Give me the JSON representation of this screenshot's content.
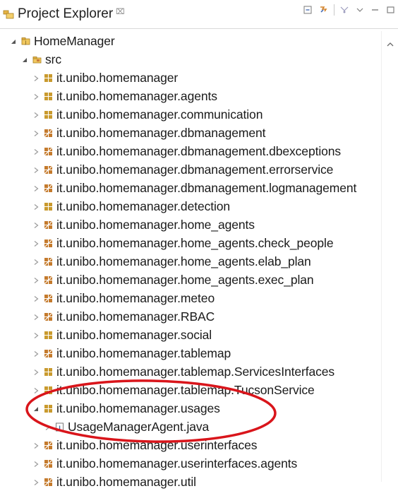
{
  "colors": {
    "annotation": "#d9151b",
    "package_accent": "#c99a2e",
    "package_alt": "#c47a2c",
    "folder": "#e6b445",
    "text": "#1a1a1a"
  },
  "view": {
    "title": "Project Explorer",
    "close_glyph": "⌧",
    "toolbar": {
      "collapse_icon": "collapse-all-icon",
      "link_icon": "link-with-editor-icon",
      "filter_icon": "filter-icon",
      "menu_icon": "view-menu-icon",
      "minimize_icon": "minimize-icon",
      "maximize_icon": "maximize-icon"
    }
  },
  "tree": {
    "project": {
      "label": "HomeManager",
      "expanded": true
    },
    "src": {
      "label": "src",
      "expanded": true
    },
    "packages": [
      {
        "label": "it.unibo.homemanager",
        "icon": "package-icon"
      },
      {
        "label": "it.unibo.homemanager.agents",
        "icon": "package-icon"
      },
      {
        "label": "it.unibo.homemanager.communication",
        "icon": "package-icon"
      },
      {
        "label": "it.unibo.homemanager.dbmanagement",
        "icon": "package-alt-icon"
      },
      {
        "label": "it.unibo.homemanager.dbmanagement.dbexceptions",
        "icon": "package-alt-icon"
      },
      {
        "label": "it.unibo.homemanager.dbmanagement.errorservice",
        "icon": "package-alt-icon"
      },
      {
        "label": "it.unibo.homemanager.dbmanagement.logmanagement",
        "icon": "package-alt-icon"
      },
      {
        "label": "it.unibo.homemanager.detection",
        "icon": "package-icon"
      },
      {
        "label": "it.unibo.homemanager.home_agents",
        "icon": "package-alt-icon"
      },
      {
        "label": "it.unibo.homemanager.home_agents.check_people",
        "icon": "package-alt-icon"
      },
      {
        "label": "it.unibo.homemanager.home_agents.elab_plan",
        "icon": "package-alt-icon"
      },
      {
        "label": "it.unibo.homemanager.home_agents.exec_plan",
        "icon": "package-alt-icon"
      },
      {
        "label": "it.unibo.homemanager.meteo",
        "icon": "package-alt-icon"
      },
      {
        "label": "it.unibo.homemanager.RBAC",
        "icon": "package-alt-icon"
      },
      {
        "label": "it.unibo.homemanager.social",
        "icon": "package-icon"
      },
      {
        "label": "it.unibo.homemanager.tablemap",
        "icon": "package-alt-icon"
      },
      {
        "label": "it.unibo.homemanager.tablemap.ServicesInterfaces",
        "icon": "package-icon"
      },
      {
        "label": "it.unibo.homemanager.tablemap.TucsonService",
        "icon": "package-icon"
      },
      {
        "label": "it.unibo.homemanager.usages",
        "icon": "package-icon",
        "expanded": true
      },
      {
        "label": "UsageManagerAgent.java",
        "icon": "java-file-icon",
        "child": true
      },
      {
        "label": "it.unibo.homemanager.userinterfaces",
        "icon": "package-alt-icon"
      },
      {
        "label": "it.unibo.homemanager.userinterfaces.agents",
        "icon": "package-alt-icon"
      },
      {
        "label": "it.unibo.homemanager.util",
        "icon": "package-alt-icon"
      }
    ]
  }
}
